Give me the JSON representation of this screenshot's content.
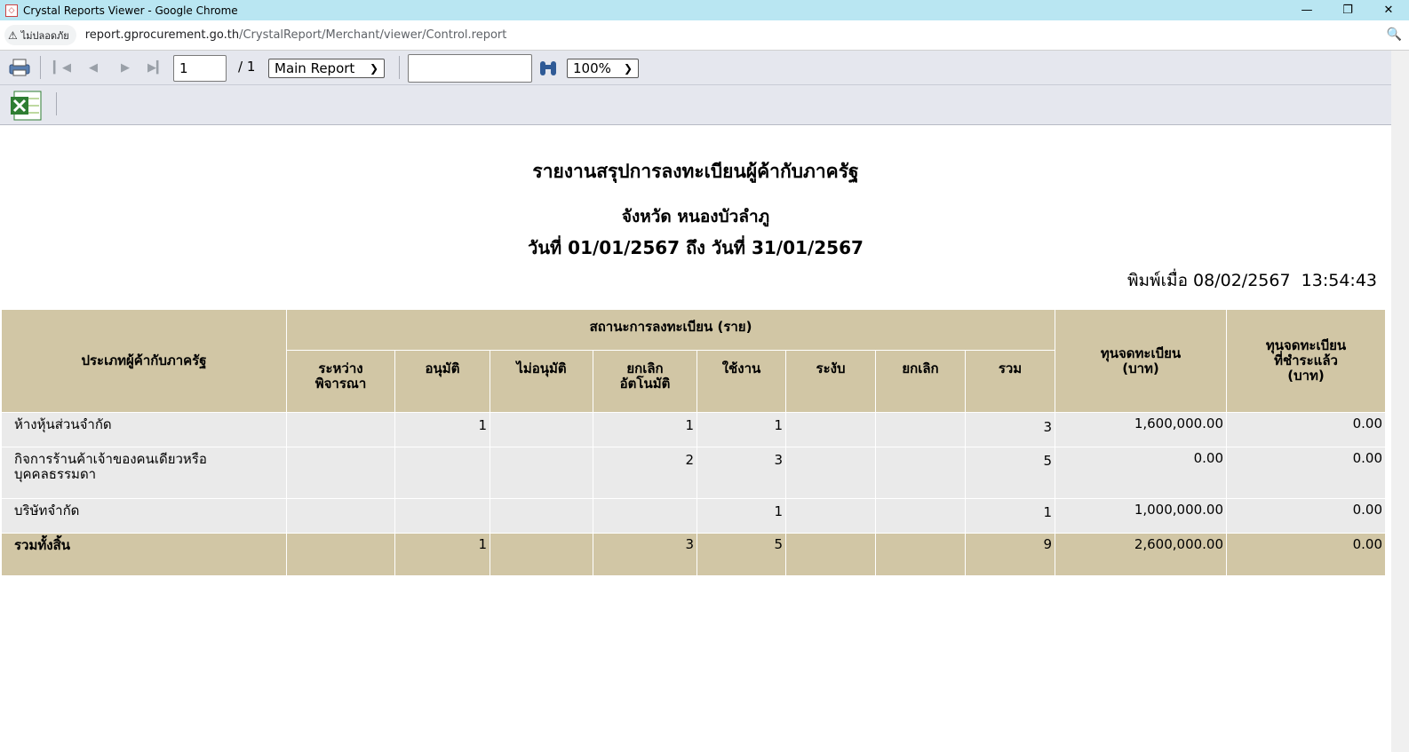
{
  "window": {
    "title": "Crystal Reports Viewer - Google Chrome"
  },
  "address": {
    "security_label": "ไม่ปลอดภัย",
    "url_host": "report.gprocurement.go.th",
    "url_path": "/CrystalReport/Merchant/viewer/Control.report"
  },
  "toolbar": {
    "page_value": "1",
    "of_pages": "/ 1",
    "report_select": "Main Report",
    "search_value": "",
    "zoom_select": "100%"
  },
  "report": {
    "title": "รายงานสรุปการลงทะเบียนผู้ค้ากับภาครัฐ",
    "province": "จังหวัด หนองบัวลำภู",
    "date_from_label": "วันที่",
    "date_from": "01/01/2567",
    "date_to_label": "ถึง วันที่",
    "date_to": "31/01/2567",
    "printed_label": "พิมพ์เมื่อ",
    "printed_date": "08/02/2567",
    "printed_time": "13:54:43"
  },
  "table": {
    "h_type": "ประเภทผู้ค้ากับภาครัฐ",
    "h_status": "สถานะการลงทะเบียน (ราย)",
    "h_pending_1": "ระหว่าง",
    "h_pending_2": "พิจารณา",
    "h_approved": "อนุมัติ",
    "h_not_approved": "ไม่อนุมัติ",
    "h_cancel_approved_1": "ยกเลิก",
    "h_cancel_approved_2": "อัตโนมัติ",
    "h_active": "ใช้งาน",
    "h_suspended": "ระงับ",
    "h_cancelled": "ยกเลิก",
    "h_sum": "รวม",
    "h_capital_1": "ทุนจดทะเบียน",
    "h_capital_2": "(บาท)",
    "h_paid_1": "ทุนจดทะเบียน",
    "h_paid_2": "ที่ชำระแล้ว",
    "h_paid_3": "(บาท)",
    "rows": [
      {
        "type_1": "ห้างหุ้นส่วนจำกัด",
        "type_2": "",
        "pending": "",
        "approved": "1",
        "not_approved": "",
        "cancel_approved": "1",
        "active": "1",
        "suspended": "",
        "cancelled": "",
        "sum": "3",
        "capital": "1,600,000.00",
        "paid": "0.00"
      },
      {
        "type_1": "กิจการร้านค้าเจ้าของคนเดียวหรือ",
        "type_2": "บุคคลธรรมดา",
        "pending": "",
        "approved": "",
        "not_approved": "",
        "cancel_approved": "2",
        "active": "3",
        "suspended": "",
        "cancelled": "",
        "sum": "5",
        "capital": "0.00",
        "paid": "0.00"
      },
      {
        "type_1": "บริษัทจำกัด",
        "type_2": "",
        "pending": "",
        "approved": "",
        "not_approved": "",
        "cancel_approved": "",
        "active": "1",
        "suspended": "",
        "cancelled": "",
        "sum": "1",
        "capital": "1,000,000.00",
        "paid": "0.00"
      }
    ],
    "total": {
      "label": "รวมทั้งสิ้น",
      "pending": "",
      "approved": "1",
      "not_approved": "",
      "cancel_approved": "3",
      "active": "5",
      "suspended": "",
      "cancelled": "",
      "sum": "9",
      "capital": "2,600,000.00",
      "paid": "0.00"
    }
  }
}
